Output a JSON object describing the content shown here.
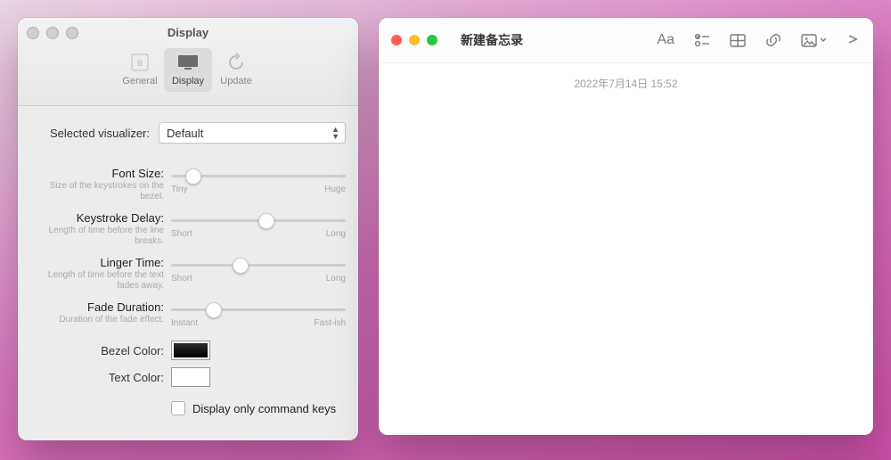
{
  "prefs": {
    "title": "Display",
    "tabs": [
      {
        "label": "General"
      },
      {
        "label": "Display"
      },
      {
        "label": "Update"
      }
    ],
    "visualizer": {
      "label": "Selected visualizer:",
      "value": "Default"
    },
    "sliders": {
      "font": {
        "label": "Font Size:",
        "hint": "Size of the keystrokes on the bezel.",
        "min": "Tiny",
        "max": "Huge",
        "pos": 8
      },
      "delay": {
        "label": "Keystroke Delay:",
        "hint": "Length of time before the line breaks.",
        "min": "Short",
        "max": "Long",
        "pos": 50
      },
      "linger": {
        "label": "Linger Time:",
        "hint": "Length of time before the text fades away.",
        "min": "Short",
        "max": "Long",
        "pos": 35
      },
      "fade": {
        "label": "Fade Duration:",
        "hint": "Duration of the fade effect.",
        "min": "Instant",
        "max": "Fast-ish",
        "pos": 20
      }
    },
    "colors": {
      "bezel": {
        "label": "Bezel Color:",
        "value": "#1a1a1a"
      },
      "text": {
        "label": "Text Color:",
        "value": "#ffffff"
      }
    },
    "checkbox": {
      "label": "Display only command keys",
      "checked": false
    }
  },
  "notes": {
    "title": "新建备忘录",
    "timestamp": "2022年7月14日 15:52"
  }
}
